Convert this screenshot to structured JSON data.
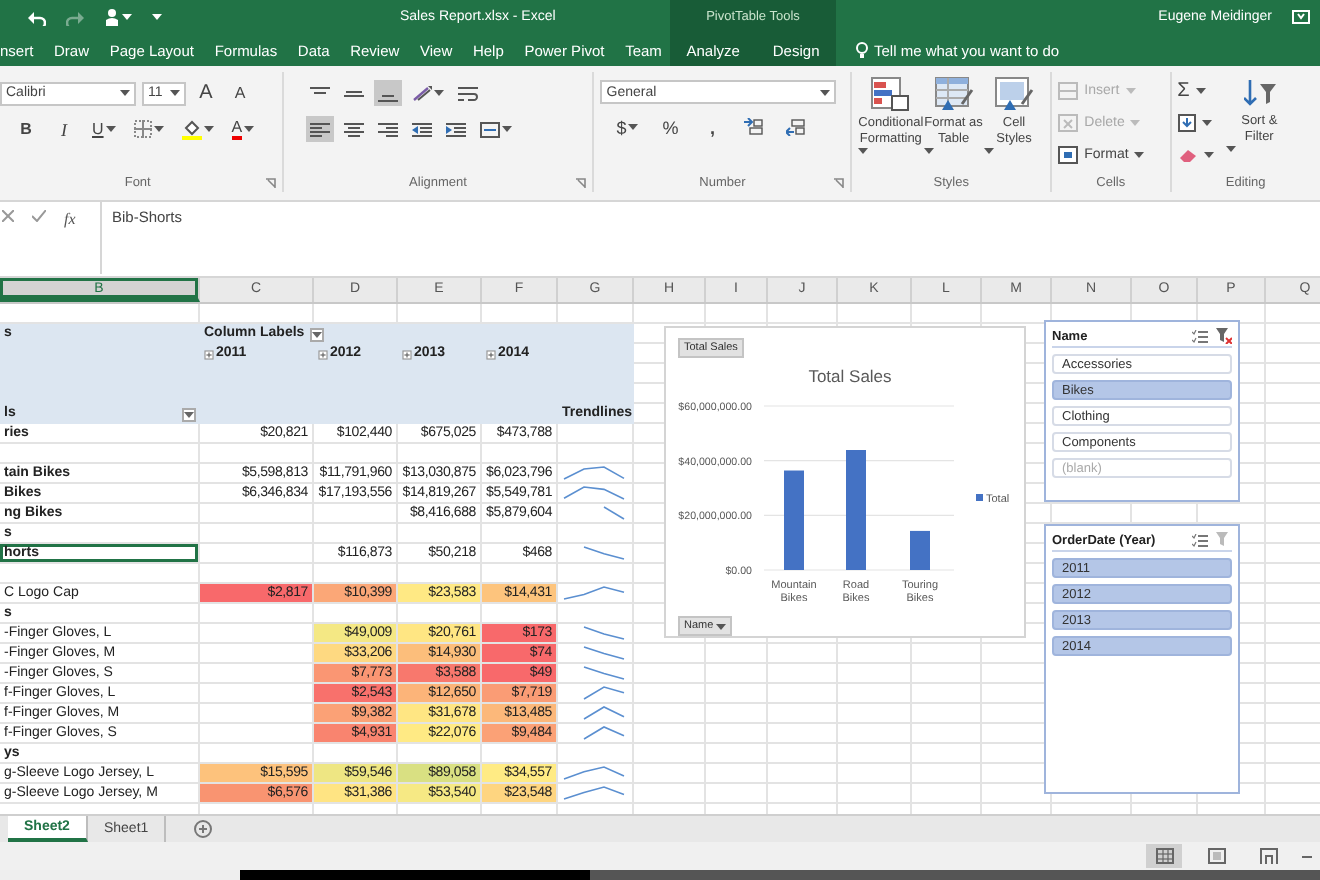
{
  "title_bar": {
    "title": "Sales Report.xlsx  -  Excel",
    "contextual_group": "PivotTable Tools",
    "user": "Eugene Meidinger"
  },
  "tabs": [
    {
      "label": "nsert",
      "contextual": false
    },
    {
      "label": "Draw",
      "contextual": false
    },
    {
      "label": "Page Layout",
      "contextual": false
    },
    {
      "label": "Formulas",
      "contextual": false
    },
    {
      "label": "Data",
      "contextual": false
    },
    {
      "label": "Review",
      "contextual": false
    },
    {
      "label": "View",
      "contextual": false
    },
    {
      "label": "Help",
      "contextual": false
    },
    {
      "label": "Power Pivot",
      "contextual": false
    },
    {
      "label": "Team",
      "contextual": false
    },
    {
      "label": "Analyze",
      "contextual": true
    },
    {
      "label": "Design",
      "contextual": true
    }
  ],
  "tell_me": "Tell me what you want to do",
  "ribbon": {
    "font": {
      "label": "Font",
      "font_name": "Calibri",
      "font_size": "11",
      "grow": "A",
      "shrink": "A",
      "bold": "B",
      "italic": "I",
      "underline": "U",
      "font_color": "A"
    },
    "alignment": {
      "label": "Alignment",
      "rows": [
        [
          {
            "kind": "align-top",
            "selected": false
          },
          {
            "kind": "align-middle",
            "selected": false
          },
          {
            "kind": "align-bottom",
            "selected": true
          },
          {
            "kind": "orientation",
            "selected": false
          },
          {
            "kind": "wrap",
            "selected": false
          }
        ],
        [
          {
            "kind": "align-left",
            "selected": true
          },
          {
            "kind": "align-center",
            "selected": false
          },
          {
            "kind": "align-right",
            "selected": false
          },
          {
            "kind": "indent-decrease",
            "selected": false
          },
          {
            "kind": "indent-increase",
            "selected": false
          },
          {
            "kind": "merge",
            "selected": false
          }
        ]
      ]
    },
    "number": {
      "label": "Number",
      "format": "General",
      "currency": "$",
      "percent": "%",
      "comma": ","
    },
    "styles": {
      "label": "Styles",
      "buttons": [
        {
          "kind": "conditional",
          "label": "Conditional Formatting"
        },
        {
          "kind": "table",
          "label": "Format as Table"
        },
        {
          "kind": "cell-styles",
          "label": "Cell Styles"
        }
      ]
    },
    "cells": {
      "label": "Cells",
      "buttons": [
        {
          "kind": "insert",
          "label": "Insert",
          "disabled": true
        },
        {
          "kind": "delete",
          "label": "Delete",
          "disabled": true
        },
        {
          "kind": "format",
          "label": "Format",
          "disabled": false
        }
      ]
    },
    "editing": {
      "label": "Editing",
      "autosum": "Σ",
      "sort_filter": "Sort & Filter"
    }
  },
  "formula_bar": {
    "fx": "fx",
    "value": "Bib-Shorts"
  },
  "columns": [
    {
      "label": "B",
      "selected": true
    },
    {
      "label": "C",
      "selected": false
    },
    {
      "label": "D",
      "selected": false
    },
    {
      "label": "E",
      "selected": false
    },
    {
      "label": "F",
      "selected": false
    },
    {
      "label": "G",
      "selected": false
    },
    {
      "label": "H",
      "selected": false
    },
    {
      "label": "I",
      "selected": false
    },
    {
      "label": "J",
      "selected": false
    },
    {
      "label": "K",
      "selected": false
    },
    {
      "label": "L",
      "selected": false
    },
    {
      "label": "M",
      "selected": false
    },
    {
      "label": "N",
      "selected": false
    },
    {
      "label": "O",
      "selected": false
    },
    {
      "label": "P",
      "selected": false
    },
    {
      "label": "Q",
      "selected": false
    }
  ],
  "pivot": {
    "header": {
      "row_label": "s",
      "column_labels": "Column Labels",
      "years": [
        "2011",
        "2012",
        "2013",
        "2014"
      ],
      "row_labels_caption": "ls",
      "trendlines": "Trendlines"
    },
    "rows": [
      {
        "kind": "category",
        "label": "ries",
        "selected": false,
        "values": {
          "c": "$20,821",
          "d": "$102,440",
          "e": "$675,025",
          "f": "$473,788"
        },
        "trendline": false
      },
      {
        "kind": "blank",
        "selected": false,
        "trendline": false
      },
      {
        "kind": "category",
        "label": "tain Bikes",
        "selected": false,
        "values": {
          "c": "$5,598,813",
          "d": "$11,791,960",
          "e": "$13,030,875",
          "f": "$6,023,796"
        },
        "trendline": true
      },
      {
        "kind": "category",
        "label": "Bikes",
        "selected": false,
        "values": {
          "c": "$6,346,834",
          "d": "$17,193,556",
          "e": "$14,819,267",
          "f": "$5,549,781"
        },
        "trendline": true
      },
      {
        "kind": "category",
        "label": "ng Bikes",
        "selected": false,
        "values": {
          "e": "$8,416,688",
          "f": "$5,879,604"
        },
        "trendline": true
      },
      {
        "kind": "category",
        "label": "s",
        "selected": false,
        "trendline": false
      },
      {
        "kind": "category",
        "label": "horts",
        "selected": true,
        "values": {
          "d": "$116,873",
          "e": "$50,218",
          "f": "$468"
        },
        "trendline": true
      },
      {
        "kind": "blank",
        "selected": false,
        "trendline": false
      },
      {
        "kind": "item",
        "label": "C Logo Cap",
        "selected": false,
        "values": {
          "c": {
            "text": "$2,817",
            "color": "#f8696b"
          },
          "d": {
            "text": "$10,399",
            "color": "#fba777"
          },
          "e": {
            "text": "$23,583",
            "color": "#ffe984"
          },
          "f": {
            "text": "$14,431",
            "color": "#fdc47d"
          }
        },
        "trendline": true
      },
      {
        "kind": "category",
        "label": "s",
        "selected": false,
        "trendline": false
      },
      {
        "kind": "item",
        "label": "-Finger Gloves, L",
        "selected": false,
        "values": {
          "d": {
            "text": "$49,009",
            "color": "#f4e884"
          },
          "e": {
            "text": "$20,761",
            "color": "#ffe683"
          },
          "f": {
            "text": "$173",
            "color": "#f8696b"
          }
        },
        "trendline": true
      },
      {
        "kind": "item",
        "label": "-Finger Gloves, M",
        "selected": false,
        "values": {
          "d": {
            "text": "$33,206",
            "color": "#fed981"
          },
          "e": {
            "text": "$14,930",
            "color": "#fcbe7b"
          },
          "f": {
            "text": "$74",
            "color": "#f8696b"
          }
        },
        "trendline": true
      },
      {
        "kind": "item",
        "label": "-Finger Gloves, S",
        "selected": false,
        "values": {
          "d": {
            "text": "$7,773",
            "color": "#fa9673"
          },
          "e": {
            "text": "$3,588",
            "color": "#f8786d"
          },
          "f": {
            "text": "$49",
            "color": "#f8696b"
          }
        },
        "trendline": true
      },
      {
        "kind": "item",
        "label": "f-Finger Gloves, L",
        "selected": false,
        "values": {
          "d": {
            "text": "$2,543",
            "color": "#f8716c"
          },
          "e": {
            "text": "$12,650",
            "color": "#fcb479"
          },
          "f": {
            "text": "$7,719",
            "color": "#fa9c75"
          }
        },
        "trendline": true
      },
      {
        "kind": "item",
        "label": "f-Finger Gloves, M",
        "selected": false,
        "values": {
          "d": {
            "text": "$9,382",
            "color": "#fba176"
          },
          "e": {
            "text": "$31,678",
            "color": "#ffe683"
          },
          "f": {
            "text": "$13,485",
            "color": "#fcb87a"
          }
        },
        "trendline": true
      },
      {
        "kind": "item",
        "label": "f-Finger Gloves, S",
        "selected": false,
        "values": {
          "d": {
            "text": "$4,931",
            "color": "#f9846f"
          },
          "e": {
            "text": "$22,076",
            "color": "#ffea84"
          },
          "f": {
            "text": "$9,484",
            "color": "#fba176"
          }
        },
        "trendline": true
      },
      {
        "kind": "category",
        "label": "ys",
        "selected": false,
        "trendline": false
      },
      {
        "kind": "item",
        "label": "g-Sleeve Logo Jersey, L",
        "selected": false,
        "values": {
          "c": {
            "text": "$15,595",
            "color": "#fdc27c"
          },
          "d": {
            "text": "$59,546",
            "color": "#eee683"
          },
          "e": {
            "text": "$89,058",
            "color": "#d9e082"
          },
          "f": {
            "text": "$34,557",
            "color": "#ffeb84"
          }
        },
        "trendline": true
      },
      {
        "kind": "item",
        "label": "g-Sleeve Logo Jersey, M",
        "selected": false,
        "values": {
          "c": {
            "text": "$6,576",
            "color": "#f99471"
          },
          "d": {
            "text": "$31,386",
            "color": "#ffe483"
          },
          "e": {
            "text": "$53,540",
            "color": "#f6e984"
          },
          "f": {
            "text": "$23,548",
            "color": "#fed580"
          }
        },
        "trendline": true
      }
    ]
  },
  "chart": {
    "field_button": "Total Sales",
    "axis_button": "Name",
    "chart_data": {
      "type": "bar",
      "title": "Total Sales",
      "categories": [
        "Mountain Bikes",
        "Road Bikes",
        "Touring Bikes"
      ],
      "series": [
        {
          "name": "Total",
          "color": "#4472c4",
          "values": [
            36400000,
            43900000,
            14300000
          ]
        }
      ],
      "ylim": [
        0,
        60000000
      ],
      "yticks": [
        {
          "value": 0,
          "label": "$0.00"
        },
        {
          "value": 20000000,
          "label": "$20,000,000.00"
        },
        {
          "value": 40000000,
          "label": "$40,000,000.00"
        },
        {
          "value": 60000000,
          "label": "$60,000,000.00"
        }
      ]
    }
  },
  "slicers": [
    {
      "title": "Name",
      "clear_filter_enabled": true,
      "items": [
        {
          "label": "Accessories",
          "selected": false,
          "disabled": false
        },
        {
          "label": "Bikes",
          "selected": true,
          "disabled": false
        },
        {
          "label": "Clothing",
          "selected": false,
          "disabled": false
        },
        {
          "label": "Components",
          "selected": false,
          "disabled": false
        },
        {
          "label": "(blank)",
          "selected": false,
          "disabled": true
        }
      ]
    },
    {
      "title": "OrderDate (Year)",
      "clear_filter_enabled": false,
      "items": [
        {
          "label": "2011",
          "selected": true,
          "disabled": false
        },
        {
          "label": "2012",
          "selected": true,
          "disabled": false
        },
        {
          "label": "2013",
          "selected": true,
          "disabled": false
        },
        {
          "label": "2014",
          "selected": true,
          "disabled": false
        }
      ]
    }
  ],
  "sheet_tabs": [
    {
      "label": "Sheet2",
      "selected": true
    },
    {
      "label": "Sheet1",
      "selected": false
    }
  ],
  "views": [
    {
      "kind": "normal",
      "selected": true
    },
    {
      "kind": "page-layout",
      "selected": false
    },
    {
      "kind": "page-break",
      "selected": false
    }
  ]
}
